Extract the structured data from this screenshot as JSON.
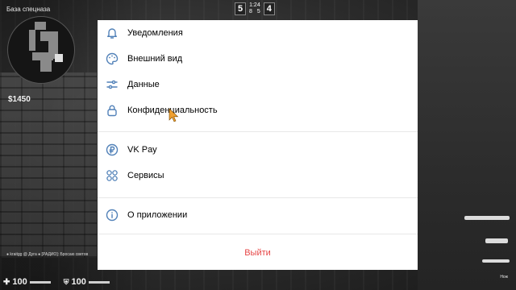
{
  "game": {
    "location": "База спецназа",
    "money": "$1450",
    "score": {
      "ct_wins": "5",
      "t_wins": "4",
      "timer": "1:24",
      "ct_alive": "8",
      "t_alive": "5"
    },
    "chat_line": "● kraitgg @ Дуга ● [РАДИО]: Бросаю светов",
    "health": "100",
    "armor": "100",
    "weapon_name": "Нож"
  },
  "menu": {
    "items": [
      {
        "label": "Уведомления",
        "icon": "bell-icon"
      },
      {
        "label": "Внешний вид",
        "icon": "palette-icon"
      },
      {
        "label": "Данные",
        "icon": "sliders-icon"
      },
      {
        "label": "Конфиденциальность",
        "icon": "lock-icon"
      },
      {
        "label": "VK Pay",
        "icon": "ruble-icon"
      },
      {
        "label": "Сервисы",
        "icon": "services-icon"
      },
      {
        "label": "О приложении",
        "icon": "info-icon"
      }
    ],
    "logout_label": "Выйти"
  },
  "colors": {
    "icon": "#5181b8",
    "logout": "#e64646",
    "text": "#000000",
    "background": "#ffffff"
  }
}
